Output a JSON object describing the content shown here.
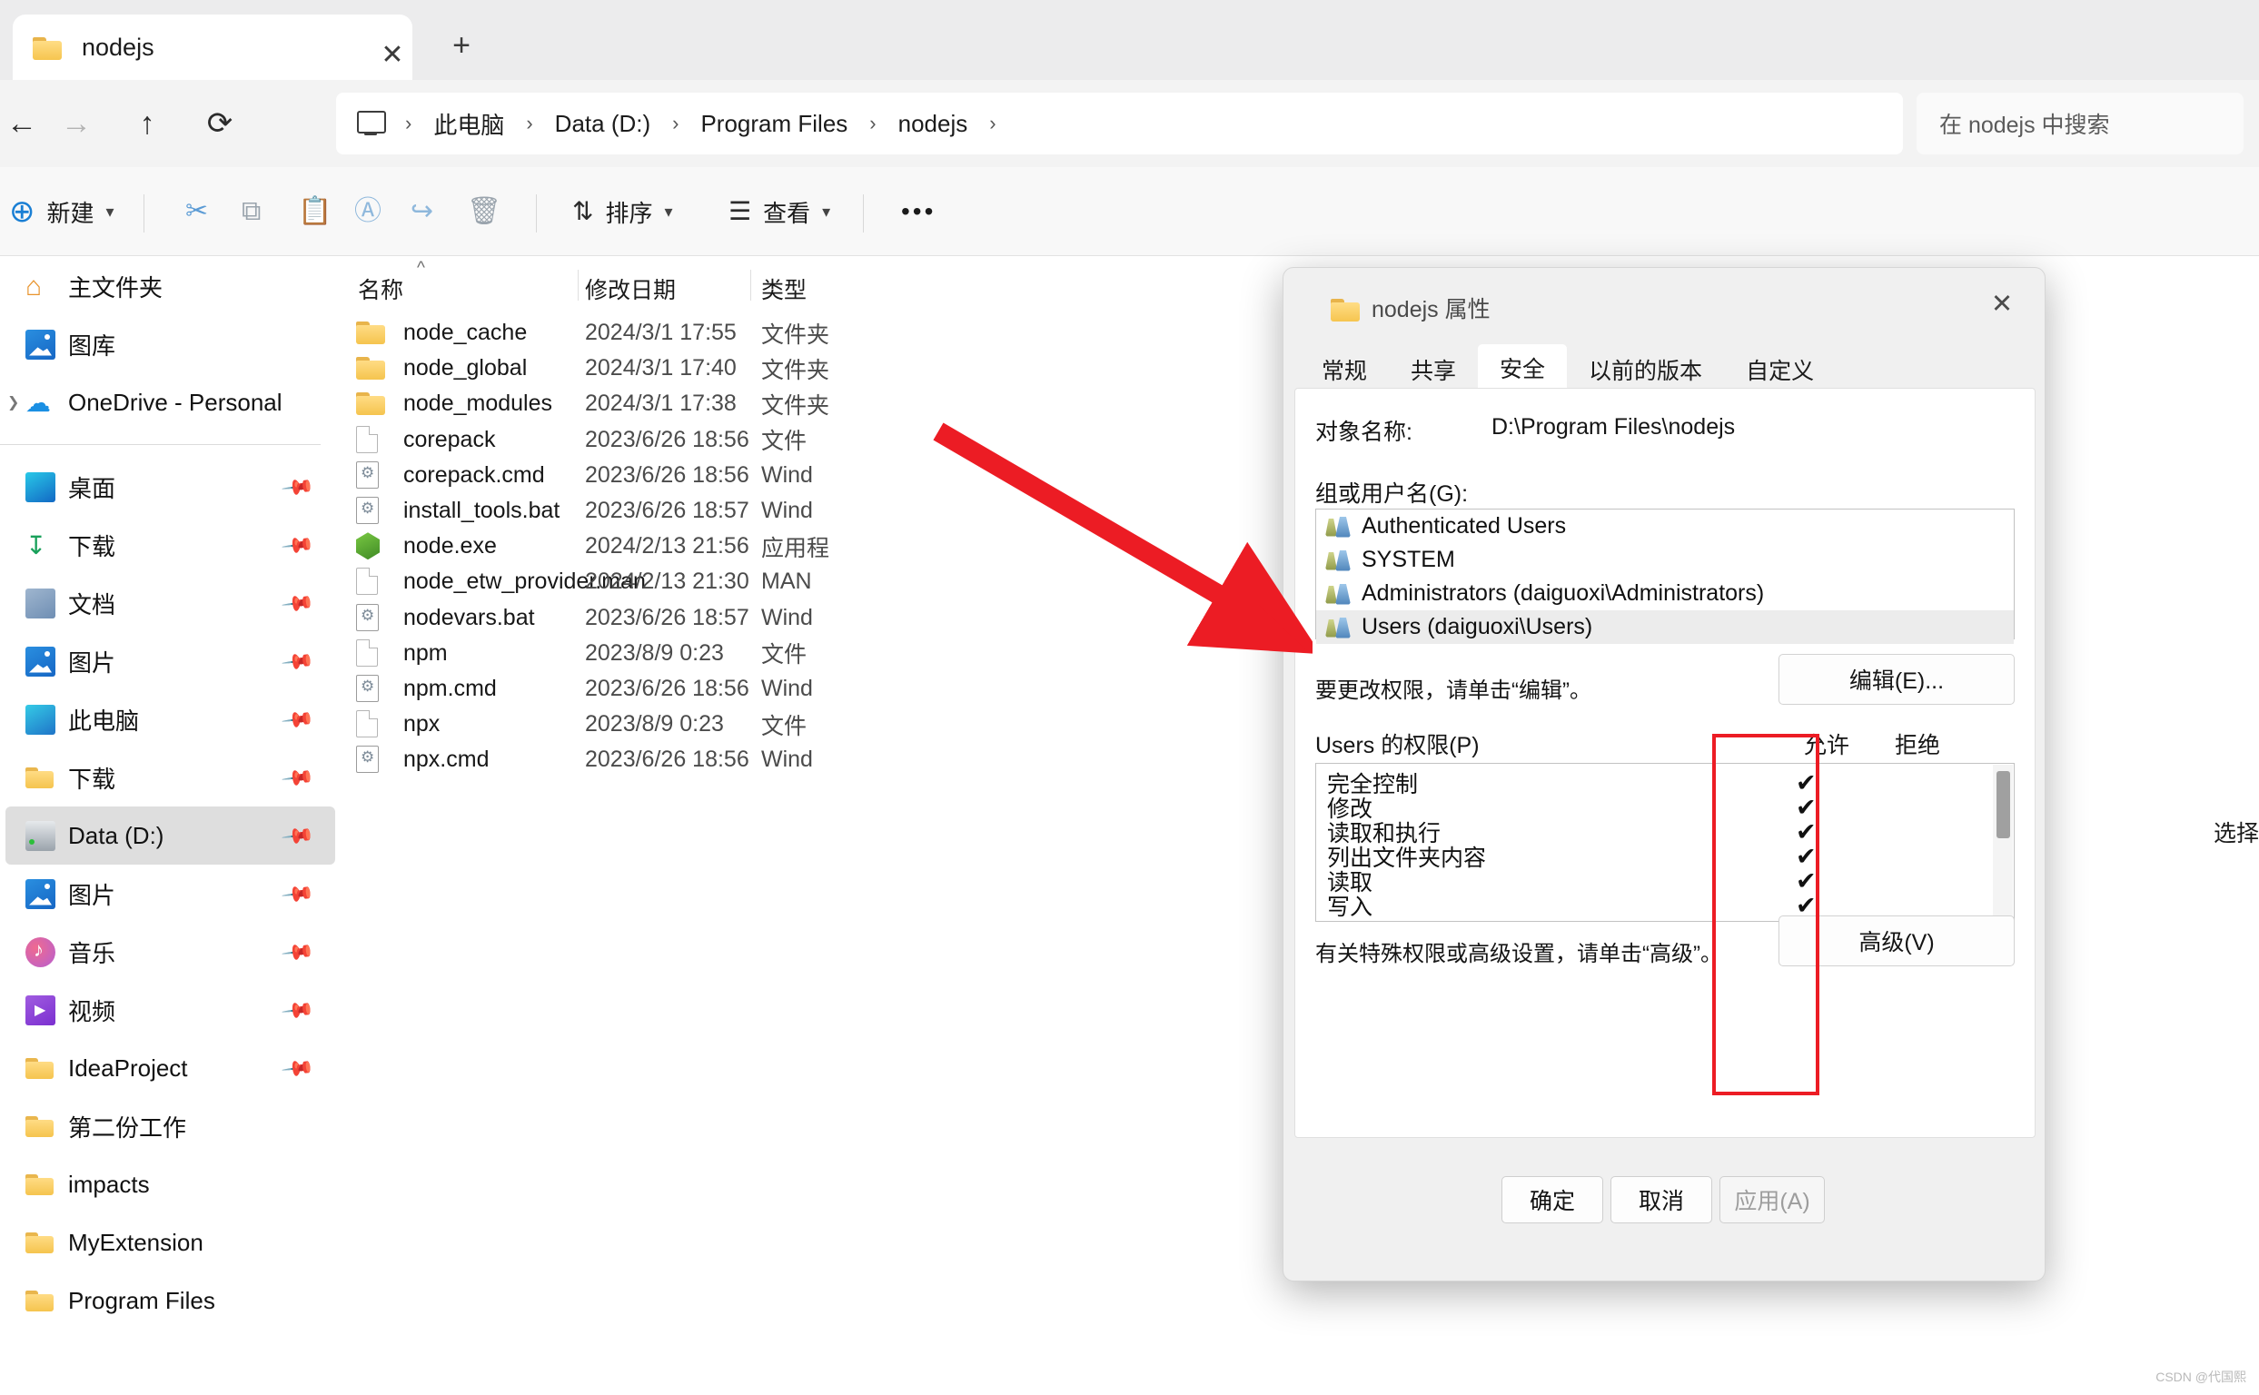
{
  "window": {
    "tab_title": "nodejs",
    "tab_close": "✕",
    "new_tab": "+"
  },
  "nav": {
    "back": "←",
    "forward": "→",
    "up": "↑",
    "refresh": "⟳",
    "breadcrumbs": [
      "此电脑",
      "Data (D:)",
      "Program Files",
      "nodejs"
    ],
    "sep": "›",
    "search_placeholder": "在 nodejs 中搜索"
  },
  "command_bar": {
    "new_label": "新建",
    "cut": "✂",
    "copy": "⧉",
    "paste": "ὌB",
    "rename": "Ⓐ",
    "share": "↪",
    "delete": "Ὕ1",
    "sort_label": "排序",
    "view_label": "查看",
    "more": "•••"
  },
  "sidebar": {
    "items": [
      {
        "label": "主文件夹",
        "icon": "home-icon",
        "pinned": false,
        "selected": false,
        "expand": false
      },
      {
        "label": "图库",
        "icon": "gallery-icon",
        "pinned": false,
        "selected": false,
        "expand": false
      },
      {
        "label": "OneDrive - Personal",
        "icon": "onedrive-icon",
        "pinned": false,
        "selected": false,
        "expand": true
      },
      {
        "label": "桌面",
        "icon": "desktop-icon",
        "pinned": true,
        "selected": false,
        "expand": false
      },
      {
        "label": "下载",
        "icon": "download-icon",
        "pinned": true,
        "selected": false,
        "expand": false
      },
      {
        "label": "文档",
        "icon": "documents-icon",
        "pinned": true,
        "selected": false,
        "expand": false
      },
      {
        "label": "图片",
        "icon": "pictures-icon",
        "pinned": true,
        "selected": false,
        "expand": false
      },
      {
        "label": "此电脑",
        "icon": "this-pc-icon",
        "pinned": true,
        "selected": false,
        "expand": false
      },
      {
        "label": "下载",
        "icon": "folder-icon",
        "pinned": true,
        "selected": false,
        "expand": false
      },
      {
        "label": "Data (D:)",
        "icon": "drive-icon",
        "pinned": true,
        "selected": true,
        "expand": false
      },
      {
        "label": "图片",
        "icon": "pictures-icon",
        "pinned": true,
        "selected": false,
        "expand": false
      },
      {
        "label": "音乐",
        "icon": "music-icon",
        "pinned": true,
        "selected": false,
        "expand": false
      },
      {
        "label": "视频",
        "icon": "video-icon",
        "pinned": true,
        "selected": false,
        "expand": false
      },
      {
        "label": "IdeaProject",
        "icon": "folder-icon",
        "pinned": true,
        "selected": false,
        "expand": false
      },
      {
        "label": "第二份工作",
        "icon": "folder-icon",
        "pinned": false,
        "selected": false,
        "expand": false
      },
      {
        "label": "impacts",
        "icon": "folder-icon",
        "pinned": false,
        "selected": false,
        "expand": false
      },
      {
        "label": "MyExtension",
        "icon": "folder-icon",
        "pinned": false,
        "selected": false,
        "expand": false
      },
      {
        "label": "Program Files",
        "icon": "folder-icon",
        "pinned": false,
        "selected": false,
        "expand": false
      }
    ]
  },
  "file_list": {
    "columns": [
      "名称",
      "修改日期",
      "类型"
    ],
    "rows": [
      {
        "name": "node_cache",
        "date": "2024/3/1 17:55",
        "type": "文件夹",
        "icon": "folder-icon"
      },
      {
        "name": "node_global",
        "date": "2024/3/1 17:40",
        "type": "文件夹",
        "icon": "folder-icon"
      },
      {
        "name": "node_modules",
        "date": "2024/3/1 17:38",
        "type": "文件夹",
        "icon": "folder-icon"
      },
      {
        "name": "corepack",
        "date": "2023/6/26 18:56",
        "type": "文件",
        "icon": "file-icon"
      },
      {
        "name": "corepack.cmd",
        "date": "2023/6/26 18:56",
        "type": "Wind",
        "icon": "cmd-icon"
      },
      {
        "name": "install_tools.bat",
        "date": "2023/6/26 18:57",
        "type": "Wind",
        "icon": "cmd-icon"
      },
      {
        "name": "node.exe",
        "date": "2024/2/13 21:56",
        "type": "应用程",
        "icon": "exe-icon"
      },
      {
        "name": "node_etw_provider.man",
        "date": "2024/2/13 21:30",
        "type": "MAN",
        "icon": "file-icon"
      },
      {
        "name": "nodevars.bat",
        "date": "2023/6/26 18:57",
        "type": "Wind",
        "icon": "cmd-icon"
      },
      {
        "name": "npm",
        "date": "2023/8/9 0:23",
        "type": "文件",
        "icon": "file-icon"
      },
      {
        "name": "npm.cmd",
        "date": "2023/6/26 18:56",
        "type": "Wind",
        "icon": "cmd-icon"
      },
      {
        "name": "npx",
        "date": "2023/8/9 0:23",
        "type": "文件",
        "icon": "file-icon"
      },
      {
        "name": "npx.cmd",
        "date": "2023/6/26 18:56",
        "type": "Wind",
        "icon": "cmd-icon"
      }
    ]
  },
  "status": {
    "selection_text": "选择"
  },
  "dialog": {
    "title": "nodejs 属性",
    "close": "✕",
    "tabs": [
      {
        "label": "常规",
        "active": false
      },
      {
        "label": "共享",
        "active": false
      },
      {
        "label": "安全",
        "active": true
      },
      {
        "label": "以前的版本",
        "active": false
      },
      {
        "label": "自定义",
        "active": false
      }
    ],
    "object_name_label": "对象名称:",
    "object_name_value": "D:\\Program Files\\nodejs",
    "group_label": "组或用户名(G):",
    "groups": [
      {
        "name": "Authenticated Users",
        "selected": false
      },
      {
        "name": "SYSTEM",
        "selected": false
      },
      {
        "name": "Administrators (daiguoxi\\Administrators)",
        "selected": false
      },
      {
        "name": "Users (daiguoxi\\Users)",
        "selected": true
      }
    ],
    "edit_hint": "要更改权限，请单击“编辑”。",
    "edit_button": "编辑(E)...",
    "permissions_label": "Users 的权限(P)",
    "allow_header": "允许",
    "deny_header": "拒绝",
    "permissions": [
      {
        "name": "完全控制",
        "allow": true,
        "deny": false
      },
      {
        "name": "修改",
        "allow": true,
        "deny": false
      },
      {
        "name": "读取和执行",
        "allow": true,
        "deny": false
      },
      {
        "name": "列出文件夹内容",
        "allow": true,
        "deny": false
      },
      {
        "name": "读取",
        "allow": true,
        "deny": false
      },
      {
        "name": "写入",
        "allow": true,
        "deny": false
      }
    ],
    "check_glyph": "✔",
    "advanced_hint": "有关特殊权限或高级设置，请单击“高级”。",
    "advanced_button": "高级(V)",
    "ok_button": "确定",
    "cancel_button": "取消",
    "apply_button": "应用(A)"
  },
  "annotation": {
    "accent_red": "#ec1c24"
  },
  "watermark": "CSDN @代国熙"
}
